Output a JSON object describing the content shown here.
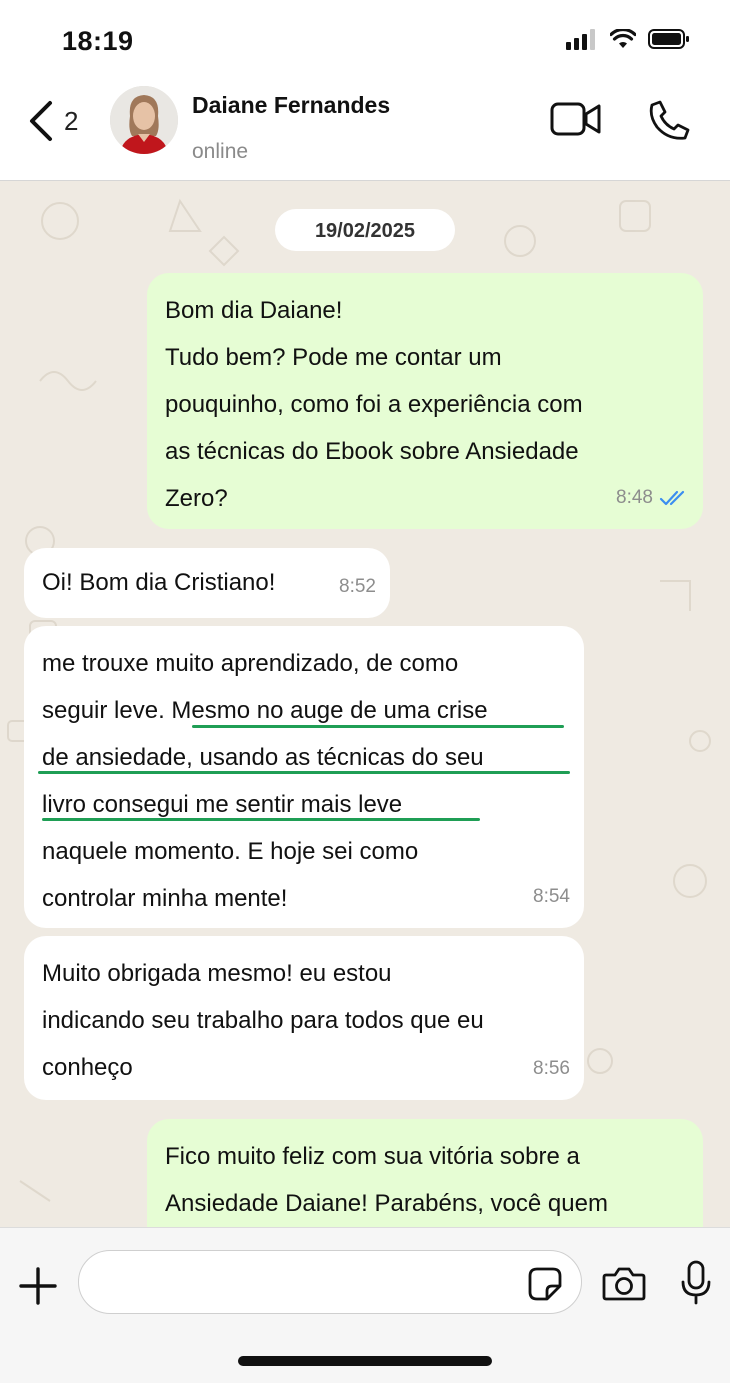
{
  "status_bar": {
    "time": "18:19"
  },
  "header": {
    "back_count": "2",
    "contact_name": "Daiane Fernandes",
    "contact_status": "online"
  },
  "chat": {
    "date": "19/02/2025",
    "messages": [
      {
        "direction": "out",
        "text": "Bom dia Daiane!\nTudo bem? Pode me contar um\npouquinho, como foi a experiência com\nas técnicas do Ebook sobre Ansiedade\nZero?",
        "time": "8:48",
        "read": true
      },
      {
        "direction": "in",
        "text": "Oi! Bom dia Cristiano!",
        "time": "8:52"
      },
      {
        "direction": "in",
        "text": "me trouxe muito aprendizado, de como\nseguir leve. Mesmo no auge de uma crise\nde ansiedade, usando as técnicas do seu\nlivro consegui me sentir mais leve\nnaquele momento. E hoje sei como\ncontrolar minha mente!",
        "time": "8:54"
      },
      {
        "direction": "in",
        "text": "Muito obrigada mesmo! eu estou\nindicando seu trabalho para todos que eu\nconheço",
        "time": "8:56"
      },
      {
        "direction": "out",
        "text": "Fico muito feliz com sua vitória sobre a\nAnsiedade Daiane! Parabéns, você quem"
      }
    ]
  },
  "input": {
    "placeholder": ""
  },
  "colors": {
    "outgoing_bubble": "#e6fdd4",
    "incoming_bubble": "#ffffff",
    "chat_background": "#efeae2",
    "highlight_underline": "#1f9e55",
    "read_ticks": "#3b8ef0"
  },
  "icons": [
    "signal-icon",
    "wifi-icon",
    "battery-icon",
    "back-chevron-icon",
    "video-call-icon",
    "phone-icon",
    "read-receipt-icon",
    "plus-icon",
    "sticker-icon",
    "camera-icon",
    "microphone-icon"
  ]
}
